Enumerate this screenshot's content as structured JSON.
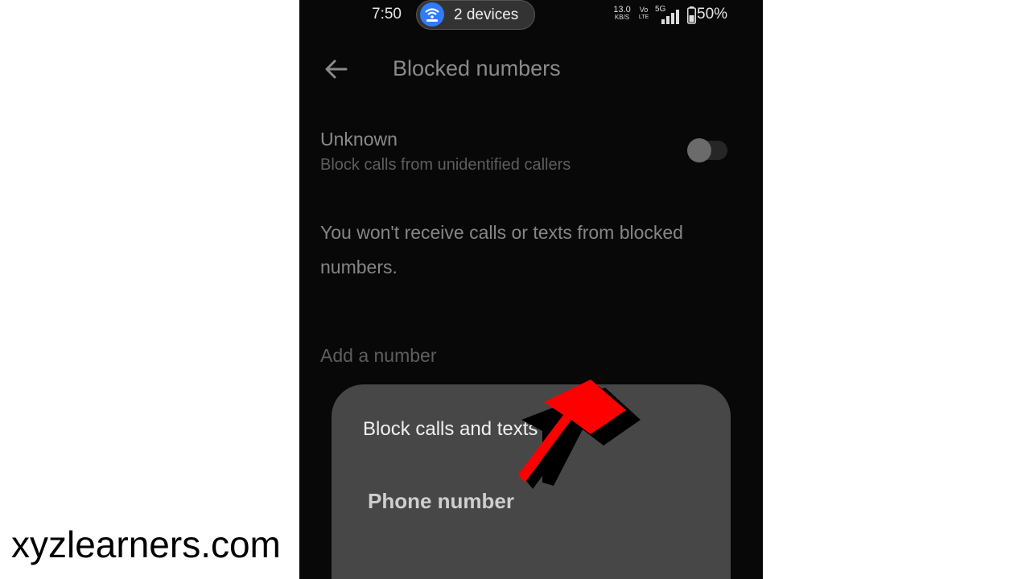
{
  "status_bar": {
    "time": "7:50",
    "hotspot_label": "2 devices",
    "hotspot_icon": "wifi-hotspot-icon",
    "rate_value": "13.0",
    "rate_unit": "KB/S",
    "volte_top": "Vo",
    "volte_bottom": "LTE",
    "network": "5G",
    "battery": "50%"
  },
  "header": {
    "title": "Blocked numbers",
    "back_icon": "arrow-left-icon"
  },
  "unknown": {
    "title": "Unknown",
    "subtitle": "Block calls from unidentified callers",
    "enabled": false
  },
  "info": "You won't receive calls or texts from blocked numbers.",
  "add_number": "Add a number",
  "sheet": {
    "title": "Block calls and texts",
    "option": "Phone number"
  },
  "annotation": {
    "arrow_color": "#ff0000"
  },
  "watermark": "xyzlearners.com"
}
